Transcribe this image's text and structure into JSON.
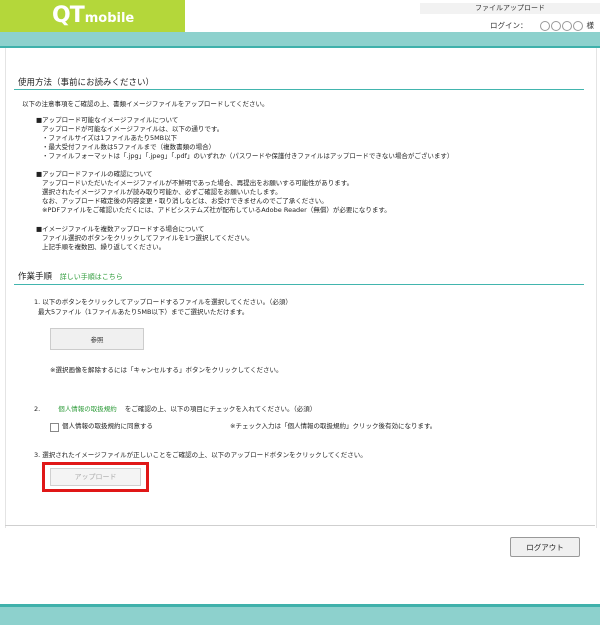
{
  "header": {
    "logo_main": "QT",
    "logo_sub": "mobile",
    "page_name": "ファイルアップロード",
    "login_label": "ログイン：",
    "honorific": "様"
  },
  "usage": {
    "title": "使用方法（事前にお読みください）",
    "intro": "以下の注意事項をご確認の上、書類イメージファイルをアップロードしてください。",
    "blocks": [
      {
        "head": "■アップロード可能なイメージファイルについて",
        "lines": [
          "アップロードが可能なイメージファイルは、以下の通りです。",
          "・ファイルサイズは1ファイルあたり5MB以下",
          "・最大受付ファイル数は5ファイルまで（複数書類の場合）",
          "・ファイルフォーマットは「.jpg」「.jpeg」「.pdf」のいずれか（パスワードや保護付きファイルはアップロードできない場合がございます）"
        ]
      },
      {
        "head": "■アップロードファイルの確認について",
        "lines": [
          "アップロードいただいたイメージファイルが不鮮明であった場合、再提出をお願いする可能性があります。",
          "選択されたイメージファイルが読み取り可能か、必ずご確認をお願いいたします。",
          "なお、アップロード確定後の内容変更・取り消しなどは、お受けできませんのでご了承ください。",
          "※PDFファイルをご確認いただくには、アドビシステムズ社が配布しているAdobe Reader（無償）が必要になります。"
        ]
      },
      {
        "head": "■イメージファイルを複数アップロードする場合について",
        "lines": [
          "ファイル選択のボタンをクリックしてファイルを1つ選択してください。",
          "上記手順を複数回、繰り返してください。"
        ]
      }
    ]
  },
  "procedure": {
    "title": "作業手順",
    "detail_link": "詳しい手順はこちら",
    "step1_line1": "1. 以下のボタンをクリックしてアップロードするファイルを選択してください。（必須）",
    "step1_line2": "最大5ファイル（1ファイルあたり5MB以下）までご選択いただけます。",
    "browse_label": "参照",
    "cancel_note": "※選択画像を解除するには「キャンセルする」ボタンをクリックしてください。",
    "step2_num": "2.",
    "step2_link": "個人情報の取扱規約",
    "step2_text": "をご確認の上、以下の項目にチェックを入れてください。（必須）",
    "agree_label": "個人情報の取扱規約に同意する",
    "check_note": "※チェック入力は「個人情報の取扱規約」クリック後有効になります。",
    "step3": "3. 選択されたイメージファイルが正しいことをご確認の上、以下のアップロードボタンをクリックしてください。",
    "upload_label": "アップロード"
  },
  "logout_label": "ログアウト",
  "colors": {
    "logo_green": "#b4d73a",
    "teal_light": "#8dd1cd",
    "teal_dark": "#3fb1ab",
    "link_green": "#2d9b39",
    "highlight_red": "#e01717"
  }
}
